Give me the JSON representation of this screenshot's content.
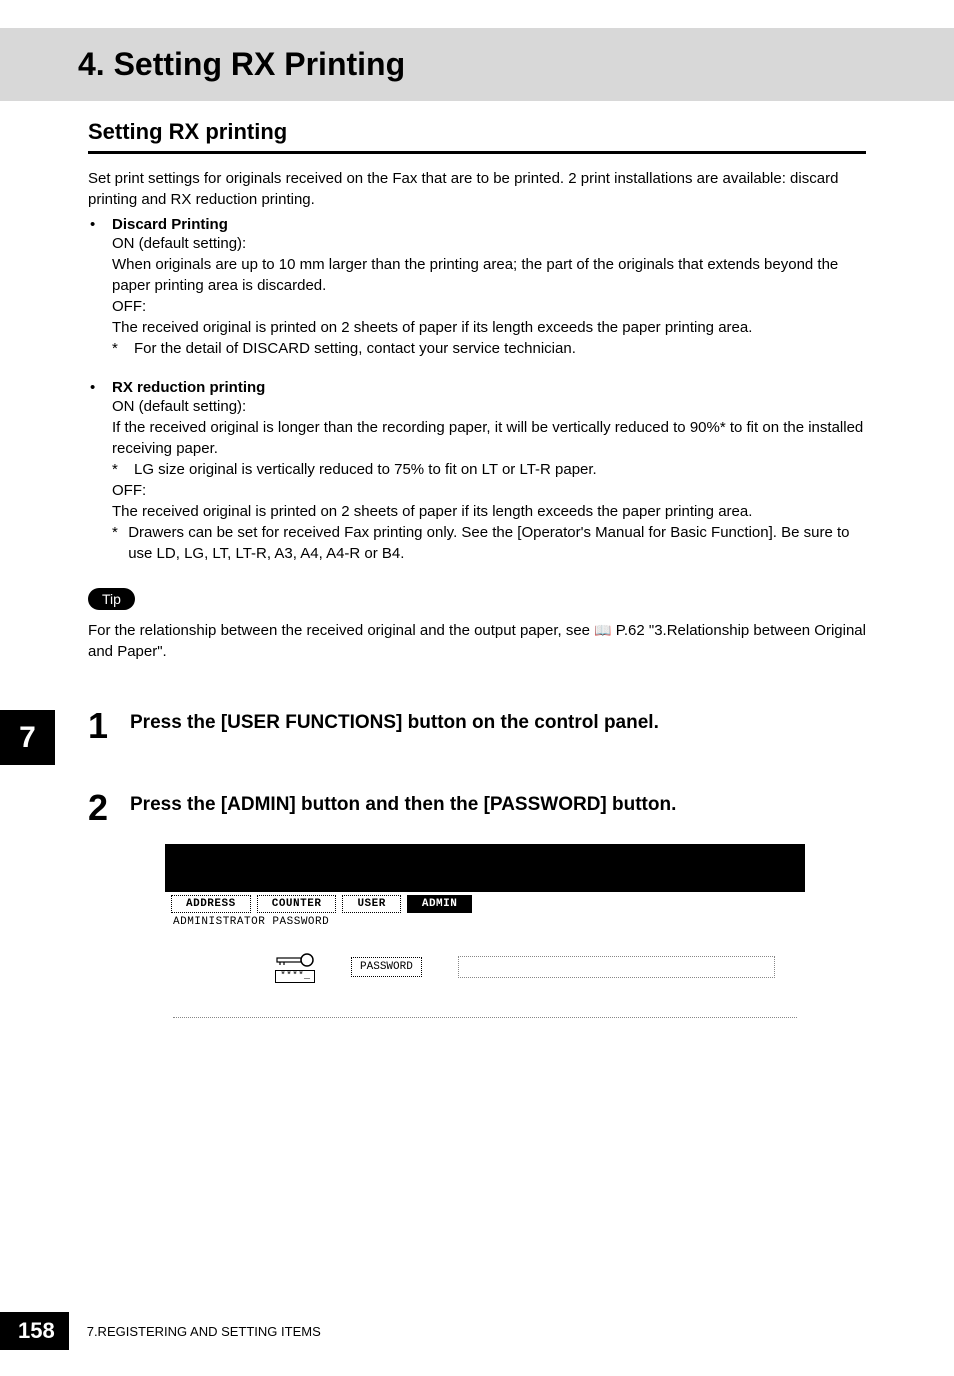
{
  "header": {
    "title": "4. Setting RX Printing"
  },
  "section": {
    "title": "Setting RX printing",
    "intro": "Set print settings for originals received on the Fax that are to be printed. 2 print installations are available: discard printing and RX reduction printing."
  },
  "discard": {
    "label": "Discard Printing",
    "on_label": "ON (default setting):",
    "on_desc": "When originals are up to 10 mm larger than the printing area; the part of the originals that extends beyond the paper printing area is discarded.",
    "off_label": "OFF:",
    "off_desc": "The received original is printed on 2 sheets of paper if its length exceeds the paper printing area.",
    "note": "For the detail of DISCARD setting, contact your service technician."
  },
  "rx": {
    "label": "RX reduction printing",
    "on_label": "ON (default setting):",
    "on_desc": "If the received original is longer than the recording paper, it will be vertically reduced to 90%* to fit on the installed receiving paper.",
    "note1": "LG size original is vertically reduced to 75% to fit on LT or LT-R paper.",
    "off_label": "OFF:",
    "off_desc": "The received original is printed on 2 sheets of paper if its length exceeds the paper printing area.",
    "note2": "Drawers can be set for received Fax printing only. See the [Operator's Manual for Basic Function]. Be sure to use LD, LG, LT, LT-R, A3, A4, A4-R or B4."
  },
  "tip": {
    "badge": "Tip",
    "text_before": "For the relationship between the received original and the output paper, see ",
    "text_after": " P.62 \"3.Relationship between Original and Paper\"."
  },
  "steps": {
    "s1_num": "1",
    "s1_text": "Press the [USER FUNCTIONS] button on the control panel.",
    "s2_num": "2",
    "s2_text": "Press the [ADMIN] button and then the [PASSWORD] button."
  },
  "screen": {
    "tabs": {
      "address": "ADDRESS",
      "counter": "COUNTER",
      "user": "USER",
      "admin": "ADMIN"
    },
    "admin_pw_label": "ADMINISTRATOR PASSWORD",
    "key_mask": "****_",
    "password_btn": "PASSWORD"
  },
  "side_tab": "7",
  "footer": {
    "page": "158",
    "chapter": "7.REGISTERING AND SETTING ITEMS"
  }
}
